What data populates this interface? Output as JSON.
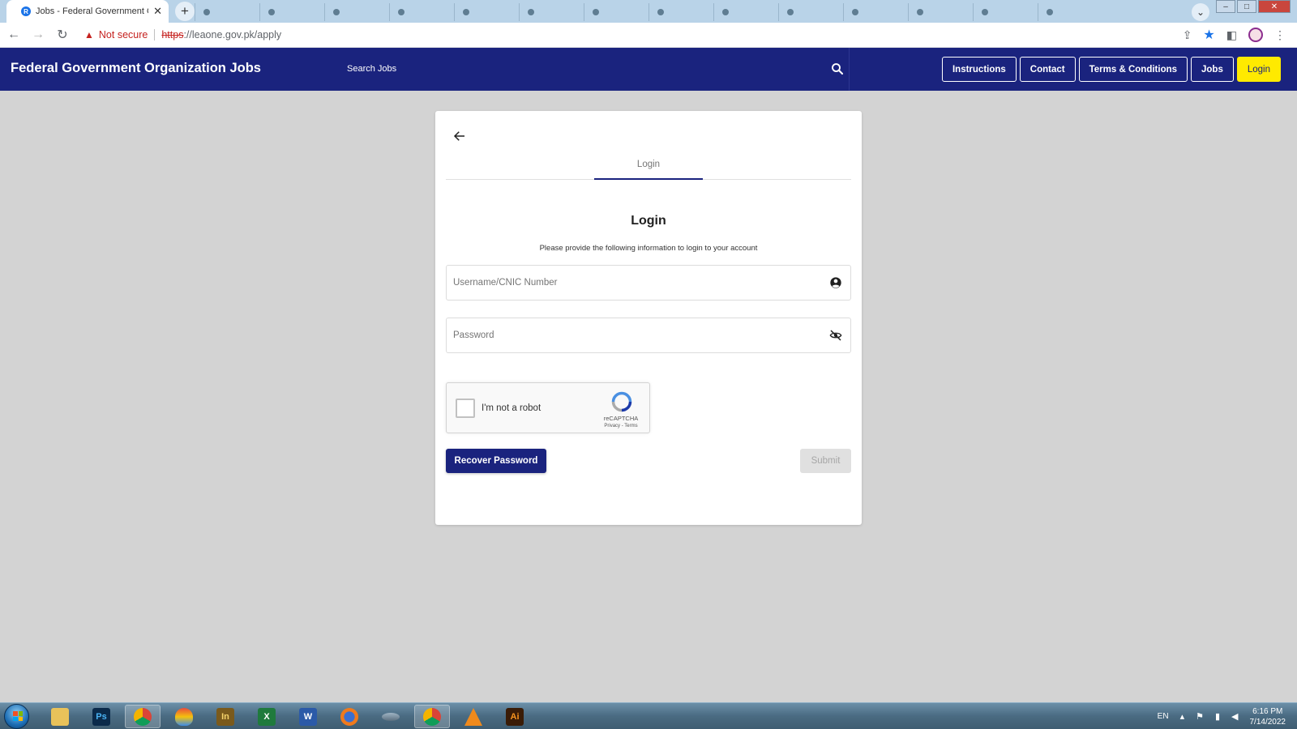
{
  "browser": {
    "active_tab_title": "Jobs - Federal Government Organ",
    "tab_favicon_letter": "R",
    "tab_close": "✕",
    "new_tab": "+",
    "security_label": "Not secure",
    "url_protocol": "https",
    "url_rest": "://leaone.gov.pk/apply"
  },
  "site": {
    "brand": "Federal Government Organization Jobs",
    "search_placeholder": "Search Jobs",
    "nav": {
      "instructions": "Instructions",
      "contact": "Contact",
      "terms": "Terms & Conditions",
      "jobs": "Jobs",
      "login": "Login"
    },
    "accent_color": "#1a237e",
    "login_button_color": "#ffea00"
  },
  "card": {
    "tab_label": "Login",
    "title": "Login",
    "subtitle": "Please provide the following information to login to your account",
    "username_placeholder": "Username/CNIC Number",
    "password_placeholder": "Password",
    "captcha_label": "I'm not a robot",
    "captcha_brand": "reCAPTCHA",
    "captcha_links": "Privacy - Terms",
    "recover_button": "Recover Password",
    "submit_button": "Submit"
  },
  "taskbar": {
    "language": "EN",
    "time": "6:16 PM",
    "date": "7/14/2022",
    "apps": [
      "windows-explorer",
      "photoshop",
      "chrome",
      "balloon-app",
      "inpage",
      "excel",
      "word",
      "firefox",
      "unknown-app",
      "chrome",
      "vlc",
      "illustrator"
    ]
  }
}
